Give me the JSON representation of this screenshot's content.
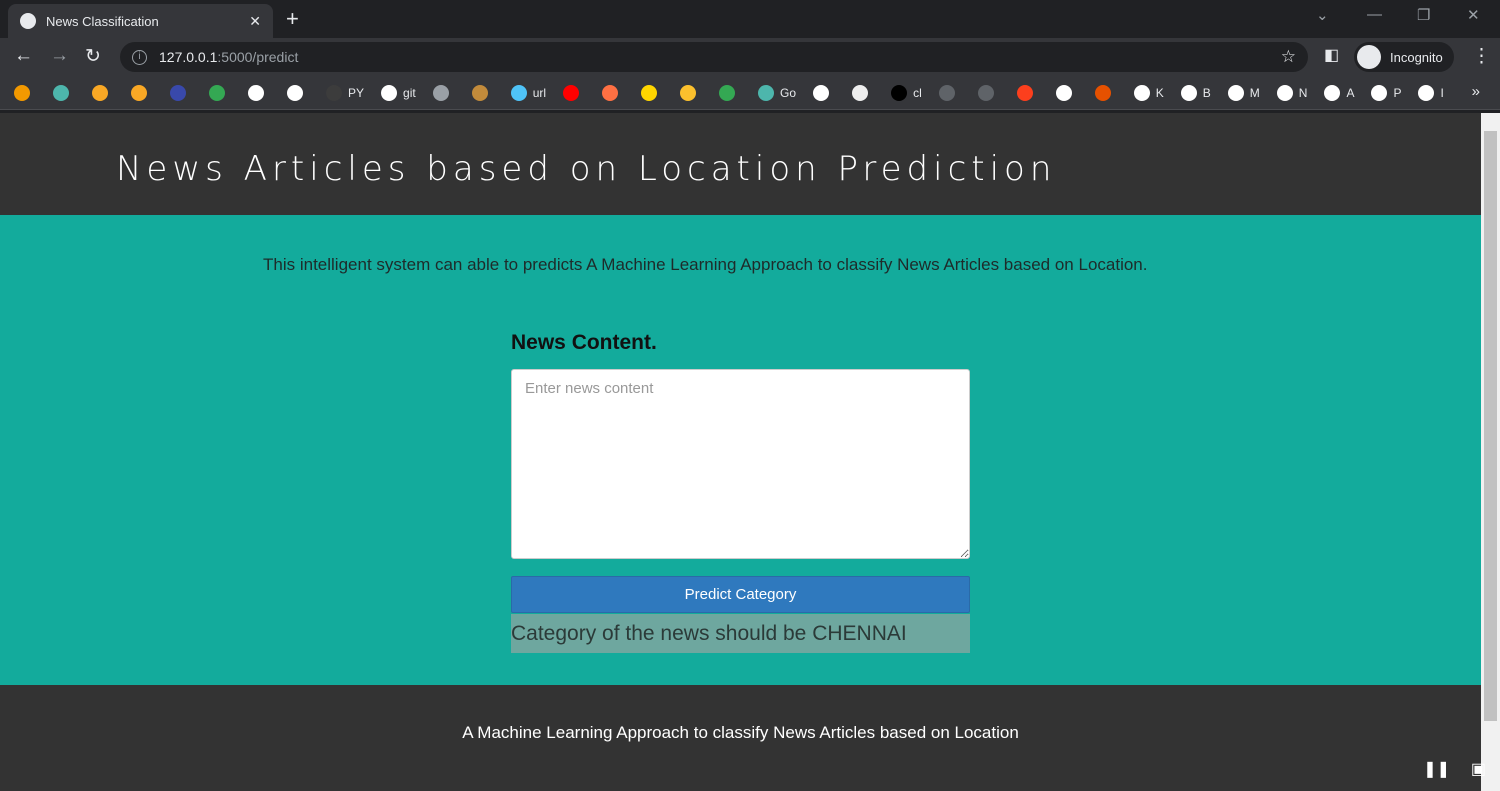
{
  "browser": {
    "tab_title": "News Classification",
    "url_host": "127.0.0.1",
    "url_path": ":5000/predict",
    "profile": "Incognito",
    "bookmarks": [
      {
        "label": "",
        "color": "#f29900"
      },
      {
        "label": "",
        "color": "#4db6ac"
      },
      {
        "label": "",
        "color": "#f9a825"
      },
      {
        "label": "",
        "color": "#f9a825"
      },
      {
        "label": "",
        "color": "#3949ab"
      },
      {
        "label": "",
        "color": "#34a853"
      },
      {
        "label": "",
        "color": "#ffffff"
      },
      {
        "label": "",
        "color": "#ffffff"
      },
      {
        "label": "PY",
        "color": "#3c3c3c"
      },
      {
        "label": "git",
        "color": "#ffffff"
      },
      {
        "label": "",
        "color": "#9aa0a6"
      },
      {
        "label": "",
        "color": "#c28b3b"
      },
      {
        "label": "url",
        "color": "#4fc3f7"
      },
      {
        "label": "",
        "color": "#ff0000"
      },
      {
        "label": "",
        "color": "#ff7043"
      },
      {
        "label": "",
        "color": "#ffd600"
      },
      {
        "label": "",
        "color": "#fbc02d"
      },
      {
        "label": "",
        "color": "#34a853"
      },
      {
        "label": "Go",
        "color": "#4db6ac"
      },
      {
        "label": "",
        "color": "#ffffff"
      },
      {
        "label": "",
        "color": "#eeeeee"
      },
      {
        "label": "cl",
        "color": "#000000"
      },
      {
        "label": "",
        "color": "#5f6368"
      },
      {
        "label": "",
        "color": "#5f6368"
      },
      {
        "label": "",
        "color": "#fc3f1d"
      },
      {
        "label": "",
        "color": "#ffffff"
      },
      {
        "label": "",
        "color": "#e65100"
      },
      {
        "label": "K",
        "color": "#ffffff"
      },
      {
        "label": "B",
        "color": "#ffffff"
      },
      {
        "label": "M",
        "color": "#ffffff"
      },
      {
        "label": "N",
        "color": "#ffffff"
      },
      {
        "label": "A",
        "color": "#ffffff"
      },
      {
        "label": "P",
        "color": "#ffffff"
      },
      {
        "label": "I",
        "color": "#ffffff"
      }
    ]
  },
  "header": {
    "title": "News Articles based on Location Prediction"
  },
  "main": {
    "intro": "This intelligent system can able to predicts A Machine Learning Approach to classify News Articles based on Location.",
    "field_label": "News Content.",
    "placeholder": "Enter news content",
    "button": "Predict Category",
    "result": "Category of the news should be CHENNAI"
  },
  "footer": {
    "text": "A Machine Learning Approach to classify News Articles based on Location"
  }
}
